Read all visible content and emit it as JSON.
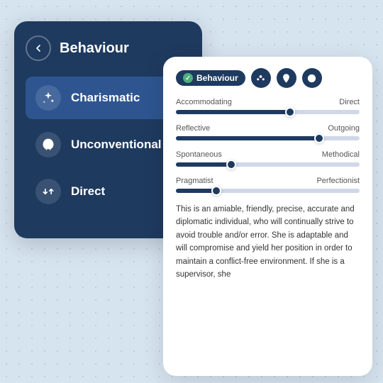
{
  "leftCard": {
    "title": "Behaviour",
    "items": [
      {
        "id": "charismatic",
        "label": "Charismatic",
        "active": true,
        "icon": "sparkles"
      },
      {
        "id": "unconventional",
        "label": "Unconventional",
        "active": false,
        "icon": "leaf"
      },
      {
        "id": "direct",
        "label": "Direct",
        "active": false,
        "icon": "arrows"
      }
    ]
  },
  "rightCard": {
    "badgeLabel": "Behaviour",
    "sliders": [
      {
        "left": "Accommodating",
        "right": "Direct",
        "pct": 62
      },
      {
        "left": "Reflective",
        "right": "Outgoing",
        "pct": 78
      },
      {
        "left": "Spontaneous",
        "right": "Methodical",
        "pct": 30
      },
      {
        "left": "Pragmatist",
        "right": "Perfectionist",
        "pct": 22
      }
    ],
    "description": "This is an amiable, friendly, precise, accurate and diplomatic individual, who will continually strive to avoid trouble and/or error. She is adaptable and will compromise and yield her position in order to maintain a conflict-free environment. If she is a supervisor, she"
  }
}
